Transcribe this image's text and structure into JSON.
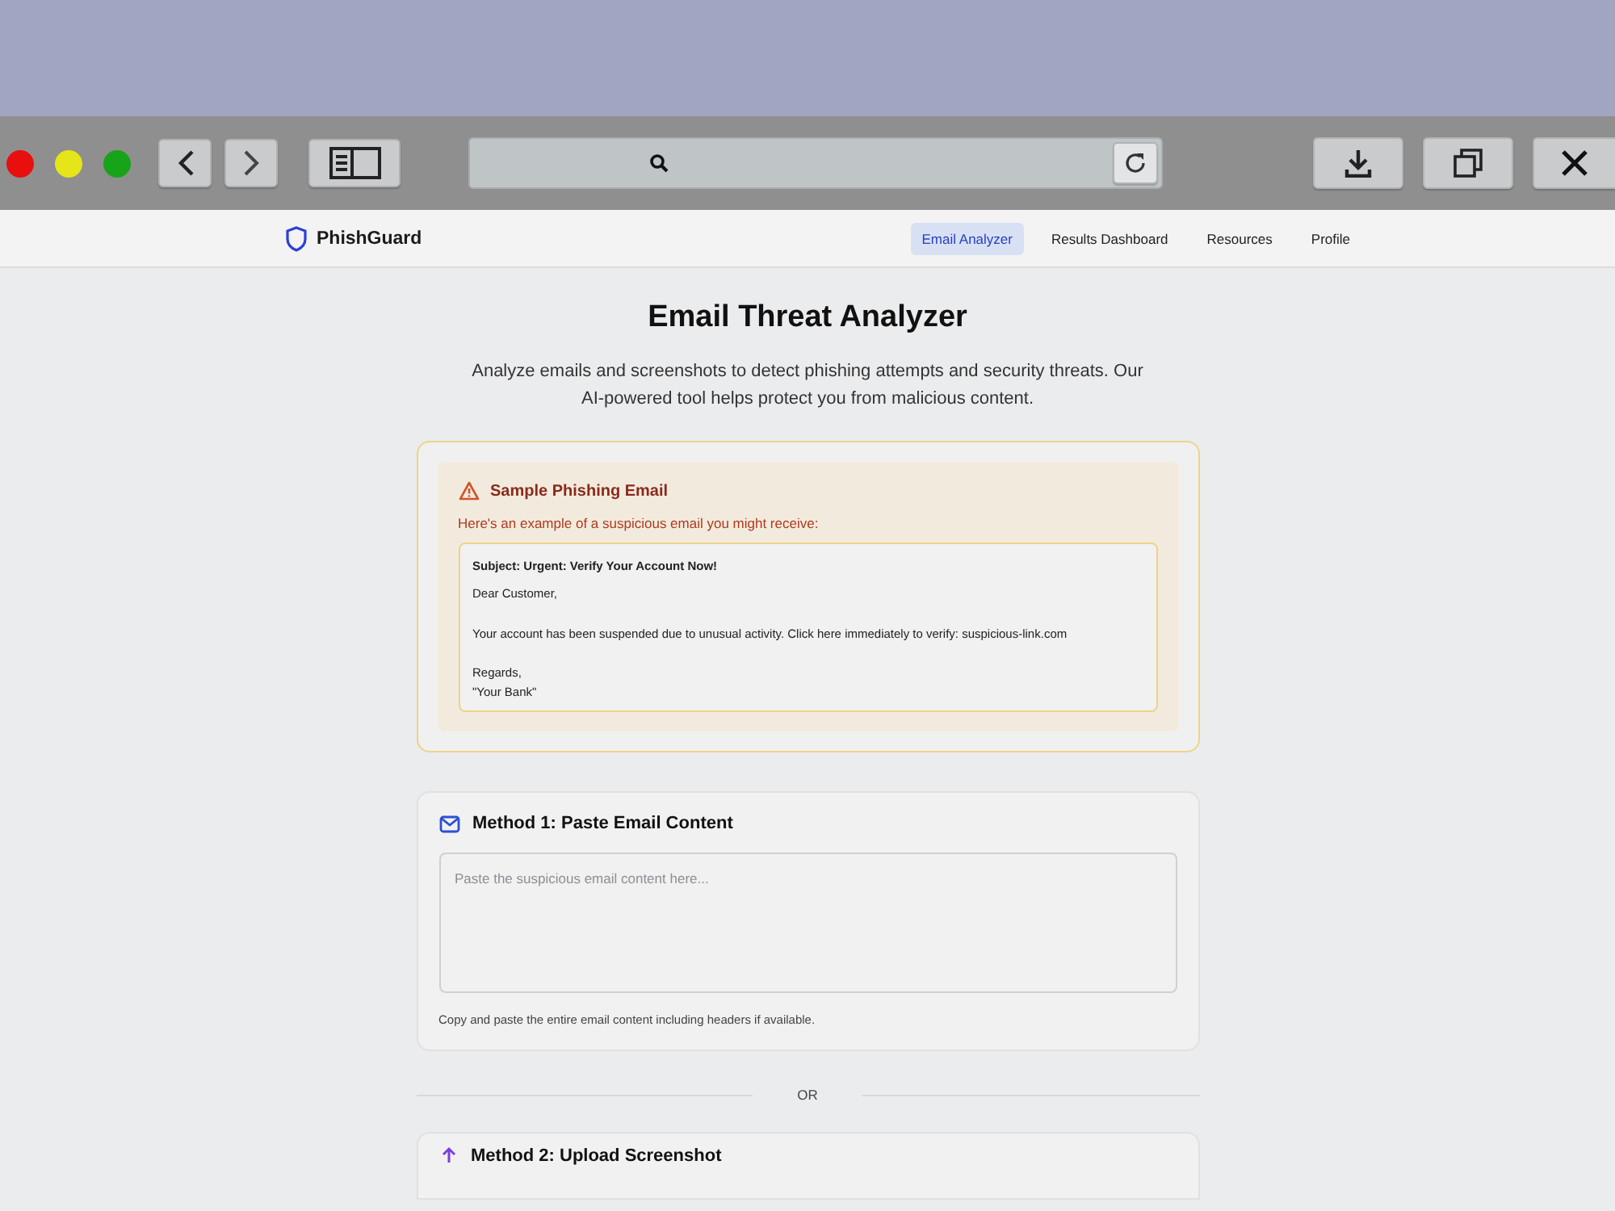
{
  "site": {
    "brand": "PhishGuard",
    "nav": [
      {
        "label": "Email Analyzer",
        "selected": true
      },
      {
        "label": "Results Dashboard",
        "selected": false
      },
      {
        "label": "Resources",
        "selected": false
      },
      {
        "label": "Profile",
        "selected": false
      }
    ]
  },
  "page": {
    "title": "Email Threat Analyzer",
    "description": "Analyze emails and screenshots to detect phishing attempts and security threats. Our AI-powered tool helps protect you from malicious content."
  },
  "sample": {
    "title": "Sample Phishing Email",
    "intro": "Here's an example of a suspicious email you might receive:",
    "email": {
      "subject": "Subject: Urgent: Verify Your Account Now!",
      "paragraphs": [
        "Dear Customer,",
        "Your account has been suspended due to unusual activity. Click here immediately to verify: suspicious-link.com",
        "Regards,\n\"Your Bank\""
      ]
    }
  },
  "method_1": {
    "title": "Method 1: Paste Email Content",
    "placeholder": "Paste the suspicious email content here...",
    "hint": "Copy and paste the entire email content including headers if available."
  },
  "divider": "OR",
  "method_2": {
    "title": "Method 2: Upload Screenshot"
  }
}
